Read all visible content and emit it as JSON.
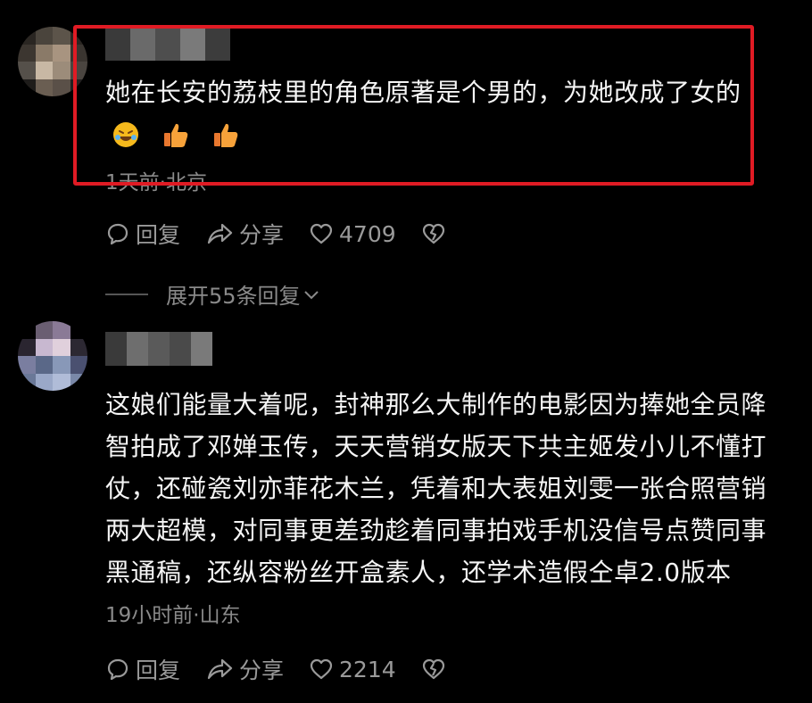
{
  "comments": [
    {
      "text": "她在长安的荔枝里的角色原著是个男的，为她改成了女的",
      "emojis": [
        "rofl-emoji",
        "thumbs-up-emoji",
        "thumbs-up-emoji"
      ],
      "meta": "1天前·北京",
      "reply_label": "回复",
      "share_label": "分享",
      "likes": "4709",
      "expand_label": "展开55条回复"
    },
    {
      "lines": [
        "这娘们能量大着呢，封神那么大制作的电影因为捧她全员降",
        "智拍成了邓婵玉传，天天营销女版天下共主姬发小儿不懂打",
        "仗，还碰瓷刘亦菲花木兰，凭着和大表姐刘雯一张合照营销",
        "两大超模，对同事更差劲趁着同事拍戏手机没信号点赞同事",
        "黑通稿，还纵容粉丝开盒素人，还学术造假仝卓2.0版本"
      ],
      "meta": "19小时前·山东",
      "reply_label": "回复",
      "share_label": "分享",
      "likes": "2214"
    }
  ],
  "colors": {
    "background": "#000000",
    "highlight": "#e01b24",
    "text": "#f5f5f5",
    "muted": "#8a8a8a"
  }
}
